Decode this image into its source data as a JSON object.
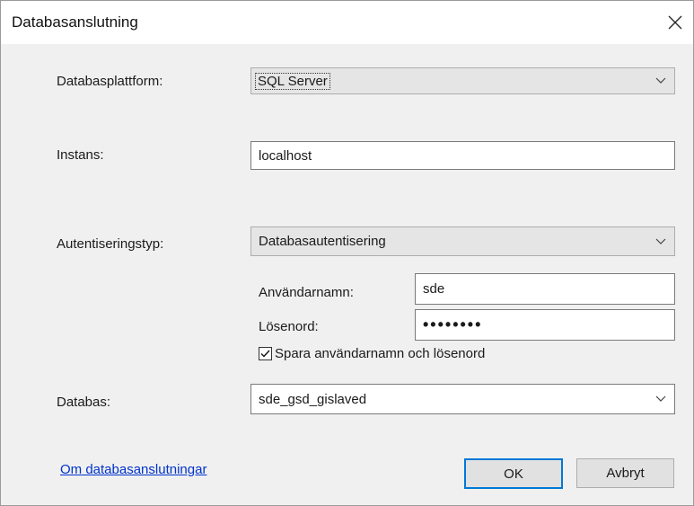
{
  "window": {
    "title": "Databasanslutning",
    "close_icon": "close-icon"
  },
  "form": {
    "platform_label": "Databasplattform:",
    "platform_value": "SQL Server",
    "instance_label": "Instans:",
    "instance_value": "localhost",
    "auth_label": "Autentiseringstyp:",
    "auth_value": "Databasautentisering",
    "username_label": "Användarnamn:",
    "username_value": "sde",
    "password_label": "Lösenord:",
    "password_value": "••••••••",
    "save_checkbox_label": "Spara användarnamn och lösenord",
    "save_checked": true,
    "database_label": "Databas:",
    "database_value": "sde_gsd_gislaved"
  },
  "footer": {
    "link_text": "Om databasanslutningar",
    "ok_label": "OK",
    "cancel_label": "Avbryt"
  },
  "colors": {
    "accent": "#0078d7",
    "link": "#0033cc"
  }
}
